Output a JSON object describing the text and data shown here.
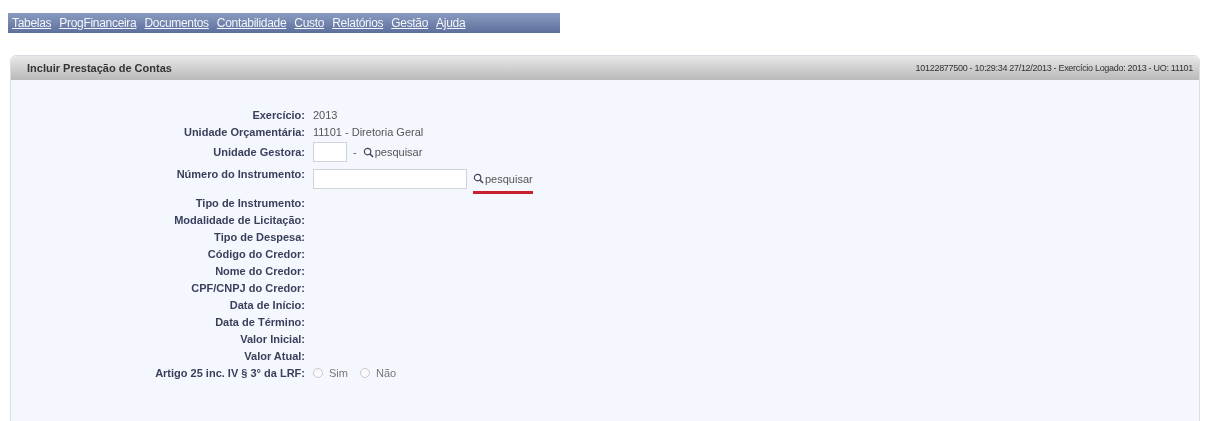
{
  "menu": [
    "Tabelas",
    "ProgFinanceira",
    "Documentos",
    "Contabilidade",
    "Custo",
    "Relatórios",
    "Gestão",
    "Ajuda"
  ],
  "panel": {
    "title": "Incluir Prestação de Contas",
    "session_info": "10122877500 - 10:29:34 27/12/2013 - Exercício Logado: 2013 - UO: 11101"
  },
  "rows": [
    {
      "label": "Exercício:",
      "kind": "text",
      "value": "2013"
    },
    {
      "label": "Unidade Orçamentária:",
      "kind": "text",
      "value": "11101 - Diretoria Geral"
    },
    {
      "label": "Unidade Gestora:",
      "kind": "code_lookup",
      "prefix": "-",
      "link": "pesquisar",
      "highlighted": false
    },
    {
      "label": "Número do Instrumento:",
      "kind": "lookup",
      "link": "pesquisar",
      "highlighted": true
    },
    {
      "label": "Tipo de Instrumento:",
      "kind": "empty"
    },
    {
      "label": "Modalidade de Licitação:",
      "kind": "empty"
    },
    {
      "label": "Tipo de Despesa:",
      "kind": "empty"
    },
    {
      "label": "Código do Credor:",
      "kind": "empty"
    },
    {
      "label": "Nome do Credor:",
      "kind": "empty"
    },
    {
      "label": "CPF/CNPJ do Credor:",
      "kind": "empty"
    },
    {
      "label": "Data de Início:",
      "kind": "empty"
    },
    {
      "label": "Data de Término:",
      "kind": "empty"
    },
    {
      "label": "Valor Inicial:",
      "kind": "empty"
    },
    {
      "label": "Valor Atual:",
      "kind": "empty"
    },
    {
      "label": "Artigo 25 inc. IV § 3° da LRF:",
      "kind": "radio",
      "options": [
        {
          "label": "Sim",
          "selected": false
        },
        {
          "label": "Não",
          "selected": false
        }
      ]
    }
  ]
}
